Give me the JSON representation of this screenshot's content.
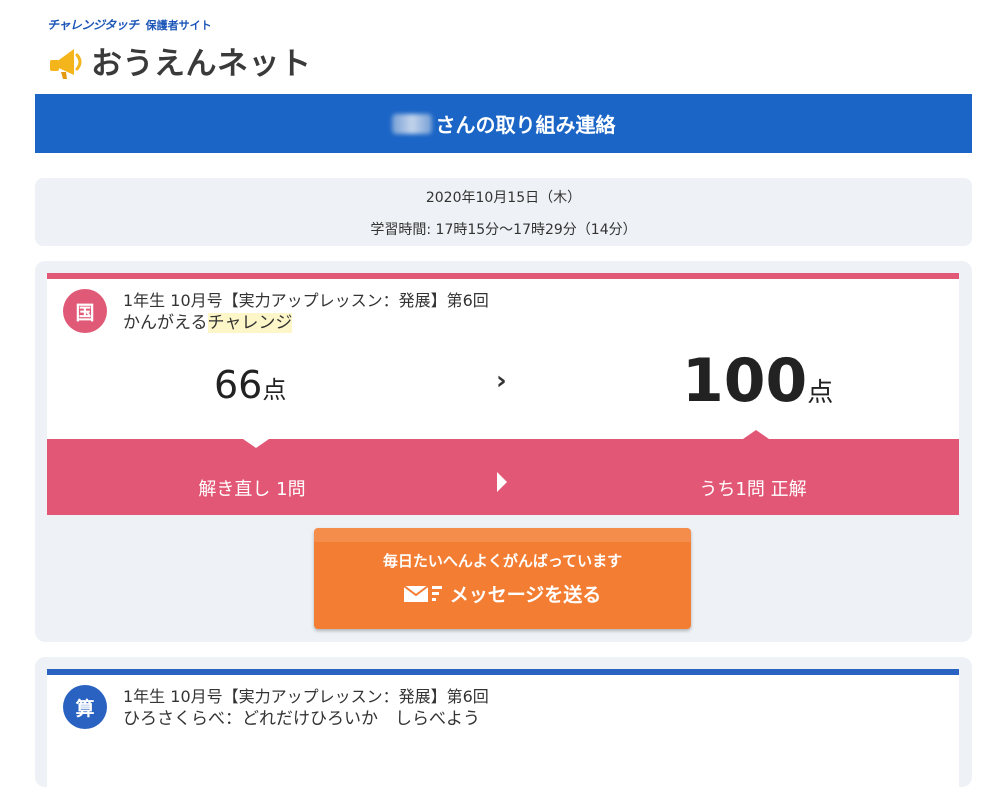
{
  "header": {
    "brand_name": "チャレンジタッチ",
    "brand_sub": "保護者サイト",
    "logo_text": "おうえんネット"
  },
  "title_bar": {
    "title_suffix": "さんの取り組み連絡"
  },
  "session": {
    "date": "2020年10月15日（木）",
    "study_time": "学習時間: 17時15分～17時29分（14分）"
  },
  "subjects": [
    {
      "badge": "国",
      "lesson": "1年生 10月号【実力アップレッスン：発展】第6回",
      "title_plain": "かんがえる",
      "title_highlight": "チャレンジ",
      "score_before": "66",
      "score_after": "100",
      "score_unit": "点",
      "arrow": "›",
      "review_label": "解き直し 1問",
      "review_result": "うち1問 正解"
    },
    {
      "badge": "算",
      "lesson": "1年生 10月号【実力アップレッスン：発展】第6回",
      "title": "ひろさくらべ：どれだけひろいか　しらべよう"
    }
  ],
  "message_button": {
    "line1": "毎日たいへんよくがんばっています",
    "line2": "メッセージを送る"
  },
  "colors": {
    "header_blue": "#1b65c6",
    "japanese_pink": "#e35776",
    "math_blue": "#2a62c2",
    "button_orange": "#f37e33",
    "panel_gray": "#eef1f5"
  }
}
